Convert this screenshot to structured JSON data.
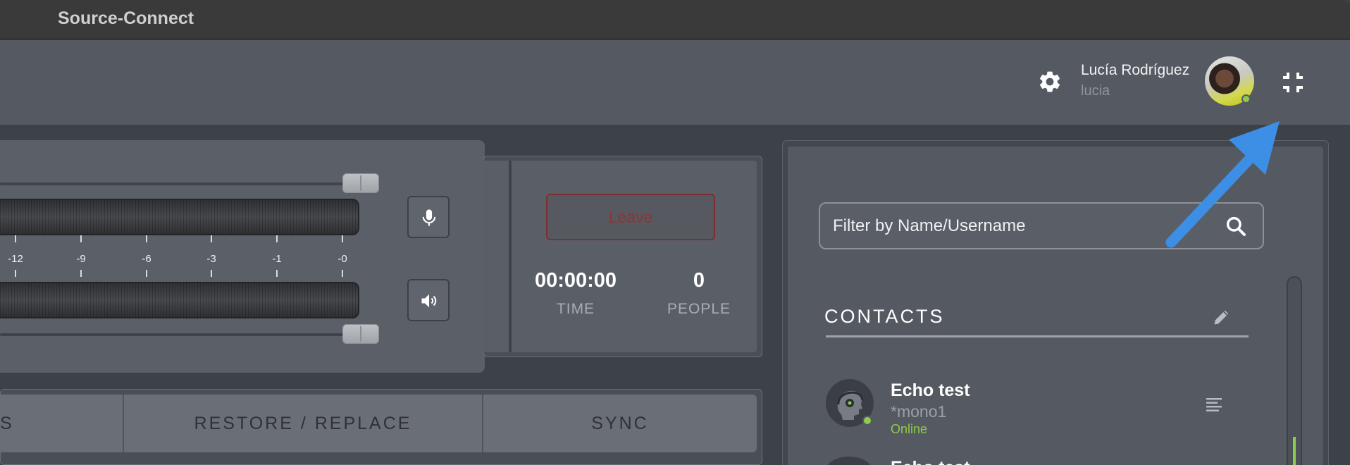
{
  "app": {
    "title": "Source-Connect"
  },
  "header": {
    "user_name": "Lucía Rodríguez",
    "user_handle": "lucia",
    "settings_icon": "gear-icon",
    "collapse_icon": "exit-fullscreen-icon"
  },
  "meter": {
    "ticks": [
      "-12",
      "-9",
      "-6",
      "-3",
      "-1",
      "-0"
    ],
    "mic_icon": "microphone-icon",
    "speaker_icon": "speaker-icon"
  },
  "session": {
    "leave_label": "Leave",
    "time_value": "00:00:00",
    "time_label": "TIME",
    "people_value": "0",
    "people_label": "PEOPLE"
  },
  "tabs": [
    "S",
    "RESTORE / REPLACE",
    "SYNC"
  ],
  "contacts": {
    "search_placeholder": "Filter by Name/Username",
    "title": "CONTACTS",
    "items": [
      {
        "name": "Echo test",
        "username": "*mono1",
        "status": "Online"
      }
    ],
    "peek_name": "Echo test"
  },
  "colors": {
    "accent_online": "#8ecb4a",
    "leave_border": "#7d2e30",
    "annotation_arrow": "#3d8fe6"
  }
}
